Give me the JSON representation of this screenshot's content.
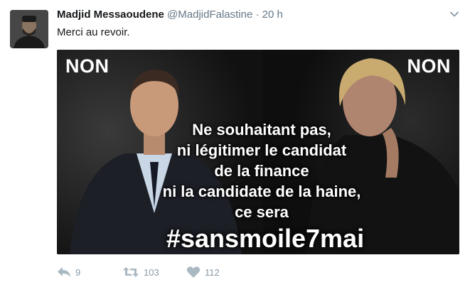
{
  "tweet": {
    "author": "Madjid Messaoudene",
    "handle": "@MadjidFalastine",
    "separator": "·",
    "time": "20 h",
    "text": "Merci au revoir.",
    "image": {
      "label_left": "NON",
      "label_right": "NON",
      "lines": [
        "Ne souhaitant pas,",
        "ni légitimer le candidat",
        "de la finance",
        "ni la candidate de la haine,",
        "ce sera"
      ],
      "hashtag": "#sansmoile7mai"
    },
    "actions": {
      "reply_count": "9",
      "retweet_count": "103",
      "like_count": "112"
    }
  },
  "colors": {
    "text_primary": "#14171a",
    "text_secondary": "#657786",
    "action_gray": "#8899a6",
    "image_bg": "#151515"
  },
  "icons": [
    "chevron-down-icon",
    "reply-icon",
    "retweet-icon",
    "like-icon"
  ]
}
